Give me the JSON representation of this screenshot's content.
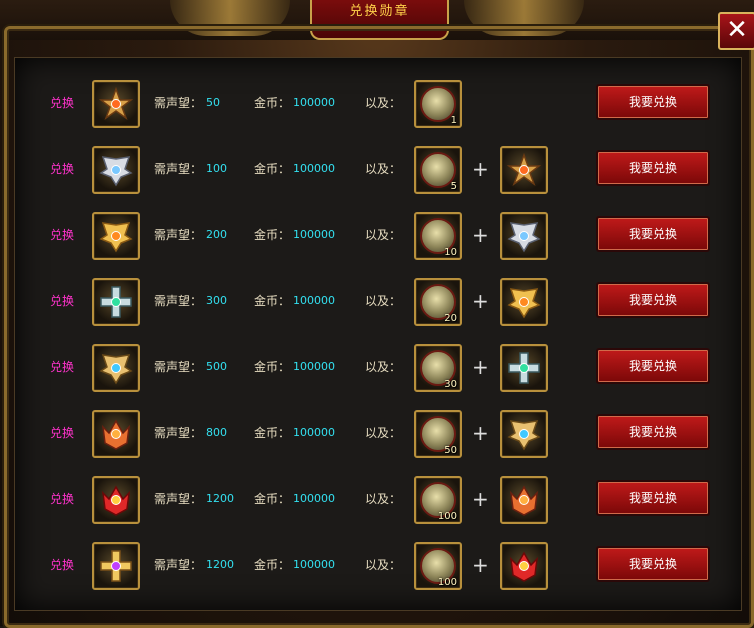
{
  "window": {
    "title": "兑换勋章",
    "close_label": "✕"
  },
  "labels": {
    "exchange": "兑换",
    "reputation": "需声望：",
    "gold": "金币：",
    "and": "以及：",
    "plus": "+",
    "button": "我要兑换"
  },
  "rows": [
    {
      "reputation": "50",
      "gold": "100000",
      "token_count": "1",
      "medal_icon": "bronze-star-medal-icon",
      "required_medal_icon": ""
    },
    {
      "reputation": "100",
      "gold": "100000",
      "token_count": "5",
      "medal_icon": "silver-wing-medal-icon",
      "required_medal_icon": "bronze-star-medal-icon"
    },
    {
      "reputation": "200",
      "gold": "100000",
      "token_count": "10",
      "medal_icon": "gold-wing-medal-icon",
      "required_medal_icon": "silver-wing-medal-icon"
    },
    {
      "reputation": "300",
      "gold": "100000",
      "token_count": "20",
      "medal_icon": "jade-cross-medal-icon",
      "required_medal_icon": "gold-wing-medal-icon"
    },
    {
      "reputation": "500",
      "gold": "100000",
      "token_count": "30",
      "medal_icon": "blue-gem-wing-medal-icon",
      "required_medal_icon": "jade-cross-medal-icon"
    },
    {
      "reputation": "800",
      "gold": "100000",
      "token_count": "50",
      "medal_icon": "fire-crown-medal-icon",
      "required_medal_icon": "blue-gem-wing-medal-icon"
    },
    {
      "reputation": "1200",
      "gold": "100000",
      "token_count": "100",
      "medal_icon": "red-crown-medal-icon",
      "required_medal_icon": "fire-crown-medal-icon"
    },
    {
      "reputation": "1200",
      "gold": "100000",
      "token_count": "100",
      "medal_icon": "purple-gem-medal-icon",
      "required_medal_icon": "red-crown-medal-icon"
    }
  ],
  "colors": {
    "exchange_label": "#ff33cc",
    "value_text": "#33e0f0",
    "button_red": "#c01a1a",
    "gold_border": "#b8903c"
  }
}
